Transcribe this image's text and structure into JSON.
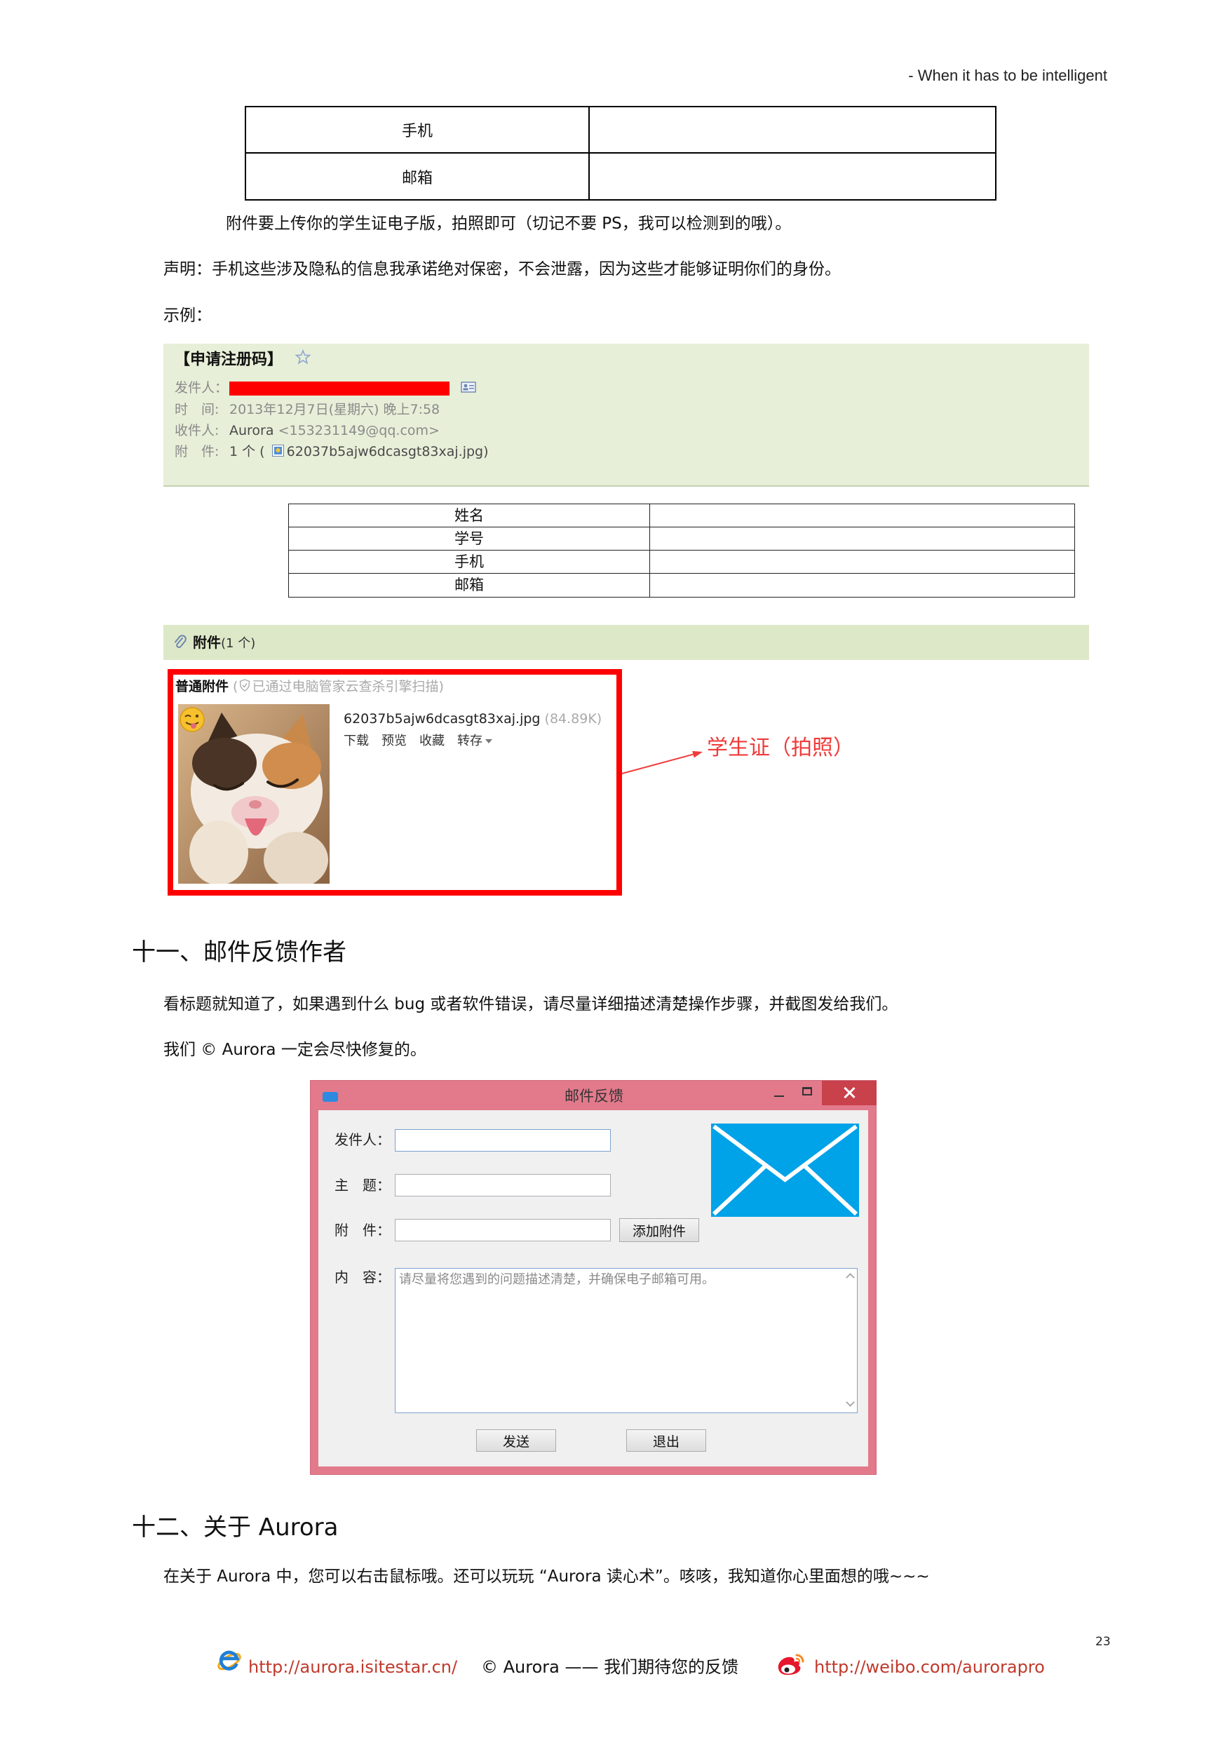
{
  "header": {
    "tagline": "- When it has to be intelligent"
  },
  "contact_table": {
    "rows": [
      {
        "label": "手机"
      },
      {
        "label": "邮箱"
      }
    ]
  },
  "notes": {
    "attachment_note": "附件要上传你的学生证电子版，拍照即可（切记不要 PS，我可以检测到的哦）。",
    "statement": "声明：手机这些涉及隐私的信息我承诺绝对保密，不会泄露，因为这些才能够证明你们的身份。",
    "example_label": "示例："
  },
  "email_example": {
    "subject": "【申请注册码】",
    "sender_label": "发件人：",
    "time_label": "时　间:",
    "time_value": "2013年12月7日(星期六) 晚上7:58",
    "recipient_label": "收件人:",
    "recipient_name": "Aurora",
    "recipient_email": "<153231149@qq.com>",
    "attachment_label": "附　件:",
    "attachment_count": "1 个 (",
    "attachment_file": "62037b5ajw6dcasgt83xaj.jpg)",
    "form_rows": [
      {
        "label": "姓名"
      },
      {
        "label": "学号"
      },
      {
        "label": "手机"
      },
      {
        "label": "邮箱"
      }
    ],
    "attachments_bar": {
      "title": "附件",
      "count": "(1 个)"
    },
    "attachment_panel": {
      "title": "普通附件",
      "scan_prefix": " (",
      "scan_note": "已通过电脑管家云查杀引擎扫描)",
      "file_name": "62037b5ajw6dcasgt83xaj.jpg",
      "file_size": "(84.89K)",
      "actions": [
        "下载",
        "预览",
        "收藏",
        "转存"
      ],
      "highlight_color": "#ff0000"
    }
  },
  "callout": {
    "label": "学生证（拍照）",
    "color": "#ef3b3b"
  },
  "section_11": {
    "heading": "十一、邮件反馈作者",
    "paragraph_1": "看标题就知道了，如果遇到什么 bug 或者软件错误，请尽量详细描述清楚操作步骤，并截图发给我们。",
    "paragraph_2": "我们 © Aurora 一定会尽快修复的。"
  },
  "feedback_dialog": {
    "title": "邮件反馈",
    "sender_label": "发件人：",
    "subject_label": "主　题：",
    "attachment_label": "附　件：",
    "add_attachment_button": "添加附件",
    "content_label": "内　容：",
    "content_placeholder": "请尽量将您遇到的问题描述清楚，并确保电子邮箱可用。",
    "send_button": "发送",
    "exit_button": "退出",
    "frame_color": "#e27a8c",
    "envelope_color": "#00a2e8"
  },
  "section_12": {
    "heading": "十二、关于 Aurora",
    "paragraph": "在关于 Aurora 中，您可以右击鼠标哦。还可以玩玩 “Aurora 读心术”。咳咳，我知道你心里面想的哦~~~"
  },
  "page_number": "23",
  "footer": {
    "site_link": "http://aurora.isitestar.cn/",
    "tagline": "© Aurora —— 我们期待您的反馈",
    "weibo_link": "http://weibo.com/aurorapro",
    "link_color": "#c0392b"
  }
}
